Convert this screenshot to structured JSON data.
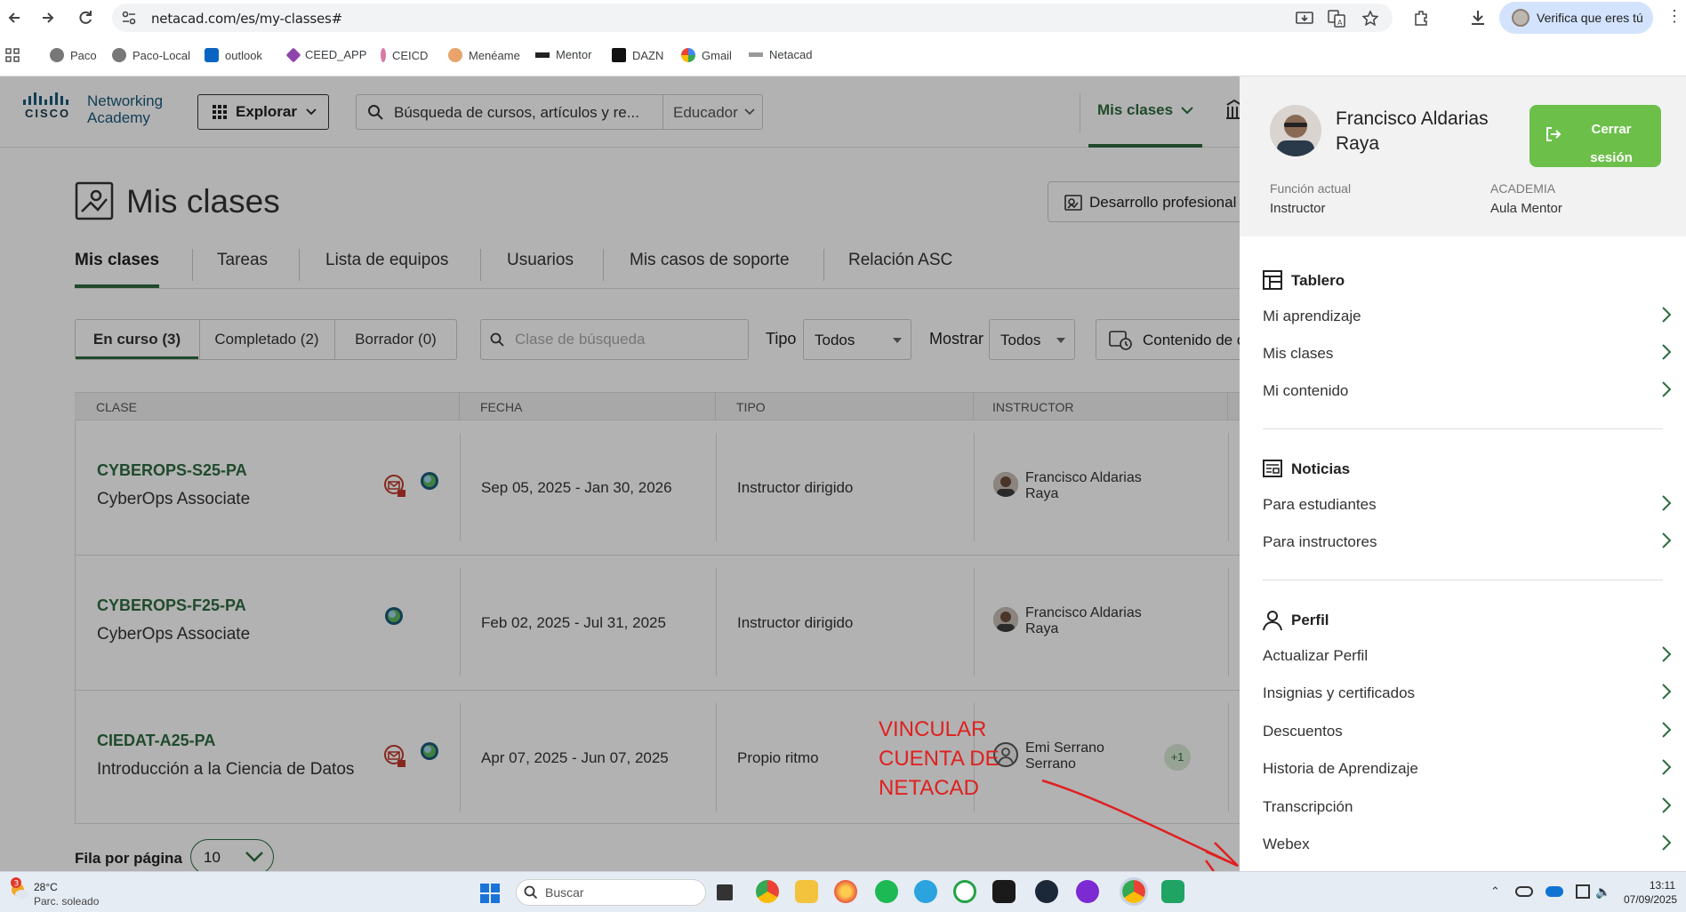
{
  "browser": {
    "url": "netacad.com/es/my-classes#",
    "verify_label": "Verifica que eres tú",
    "bookmarks": [
      "Paco",
      "Paco-Local",
      "outlook",
      "CEED_APP",
      "CEICD",
      "Menéame",
      "Mentor",
      "DAZN",
      "Gmail",
      "Netacad"
    ]
  },
  "header": {
    "logo_cisco": "CISCO",
    "logo_line1": "Networking",
    "logo_line2": "Academy",
    "explore": "Explorar",
    "search_placeholder": "Búsqueda de cursos, artículos y re...",
    "role": "Educador",
    "my_classes_nav": "Mis clases"
  },
  "page": {
    "title": "Mis clases",
    "dev_pro": "Desarrollo profesional",
    "tabs": [
      "Mis clases",
      "Tareas",
      "Lista de equipos",
      "Usuarios",
      "Mis casos de soporte",
      "Relación ASC"
    ],
    "filters": [
      "En curso (3)",
      "Completado (2)",
      "Borrador (0)"
    ],
    "class_search_placeholder": "Clase de búsqueda",
    "type_label": "Tipo",
    "type_value": "Todos",
    "show_label": "Mostrar",
    "show_value": "Todos",
    "content_btn": "Contenido de c",
    "rows_label": "Fila por página",
    "rows_value": "10"
  },
  "table": {
    "headers": [
      "Clase",
      "Fecha",
      "Tipo",
      "Instructor"
    ],
    "rows": [
      {
        "code": "CYBEROPS-S25-PA",
        "name": "CyberOps Associate",
        "date": "Sep 05, 2025 - Jan 30, 2026",
        "type": "Instructor dirigido",
        "instructor": "Francisco Aldarias Raya"
      },
      {
        "code": "CYBEROPS-F25-PA",
        "name": "CyberOps Associate",
        "date": "Feb 02, 2025 - Jul 31, 2025",
        "type": "Instructor dirigido",
        "instructor": "Francisco Aldarias Raya"
      },
      {
        "code": "CIEDAT-A25-PA",
        "name": "Introducción a la Ciencia de Datos",
        "date": "Apr 07, 2025 - Jun 07, 2025",
        "type": "Propio ritmo",
        "instructor": "Emi Serrano Serrano",
        "extra": "+1"
      }
    ]
  },
  "drawer": {
    "user_name": "Francisco Aldarias Raya",
    "logout": "Cerrar sesión",
    "role_label": "Función actual",
    "role_value": "Instructor",
    "academy_label": "ACADEMIA",
    "academy_value": "Aula Mentor",
    "sections": [
      {
        "title": "Tablero",
        "items": [
          "Mi aprendizaje",
          "Mis clases",
          "Mi contenido"
        ]
      },
      {
        "title": "Noticias",
        "items": [
          "Para estudiantes",
          "Para instructores"
        ]
      },
      {
        "title": "Perfil",
        "items": [
          "Actualizar Perfil",
          "Insignias y certificados",
          "Descuentos",
          "Historia de Aprendizaje",
          "Transcripción",
          "Webex"
        ]
      }
    ]
  },
  "annotation": {
    "text": "VINCULAR CUENTA DE NETACAD",
    "color": "#e02020"
  },
  "taskbar": {
    "weather_badge": "3",
    "temp": "28°C",
    "weather": "Parc. soleado",
    "search": "Buscar",
    "time": "13:11",
    "date": "07/09/2025"
  },
  "colors": {
    "brand_green": "#2e6b3f",
    "logout_green": "#6cc04a",
    "cisco_blue": "#1b5a7c"
  }
}
